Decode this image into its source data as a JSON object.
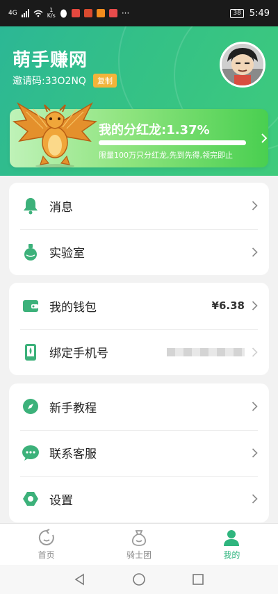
{
  "status_bar": {
    "network": "4G",
    "speed_value": "1",
    "speed_unit": "K/s",
    "more": "···",
    "battery": "38",
    "time": "5:49"
  },
  "header": {
    "app_title": "萌手赚网",
    "invite_code": "邀请码:33O2NQ",
    "copy_label": "复制"
  },
  "banner": {
    "title": "我的分红龙:1.37%",
    "progress_percent": 100,
    "subtitle": "限量100万只分红龙,先到先得,领完即止"
  },
  "menu_group_1": [
    {
      "label": "消息",
      "icon": "bell-icon"
    },
    {
      "label": "实验室",
      "icon": "flask-icon"
    }
  ],
  "menu_group_2": [
    {
      "label": "我的钱包",
      "icon": "wallet-icon",
      "value": "¥6.38"
    },
    {
      "label": "绑定手机号",
      "icon": "phone-icon"
    }
  ],
  "menu_group_3": [
    {
      "label": "新手教程",
      "icon": "compass-icon"
    },
    {
      "label": "联系客服",
      "icon": "chat-bubble-icon"
    },
    {
      "label": "设置",
      "icon": "hexagon-settings-icon"
    }
  ],
  "bottom_nav": [
    {
      "label": "首页",
      "icon": "home-refresh-icon",
      "active": false
    },
    {
      "label": "骑士团",
      "icon": "money-bag-icon",
      "active": false
    },
    {
      "label": "我的",
      "icon": "user-icon",
      "active": true
    }
  ],
  "colors": {
    "accent": "#2fb57e",
    "header_start": "#2cb795",
    "header_end": "#3fcb7c",
    "copy_badge": "#f3b43a",
    "inactive_nav": "#8c8c8c"
  }
}
